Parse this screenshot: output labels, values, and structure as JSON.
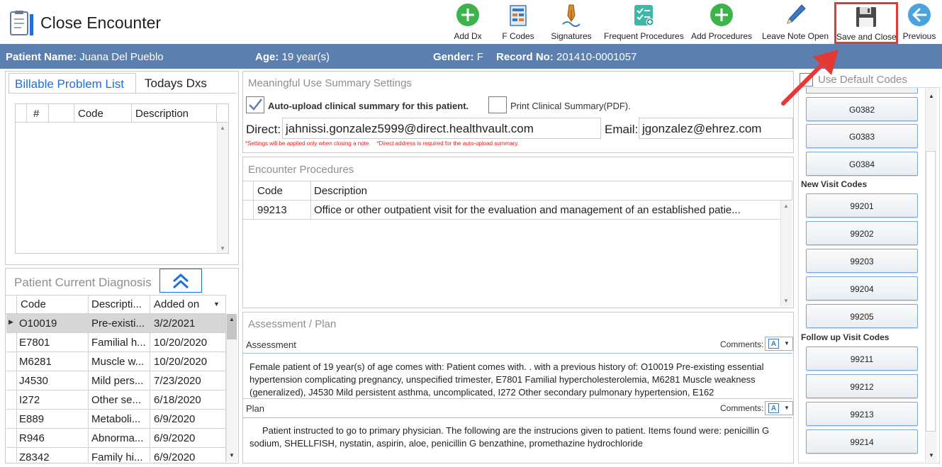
{
  "app": {
    "title": "Close Encounter"
  },
  "toolbar": [
    {
      "label": "Add Dx",
      "icon": "add-dx-icon"
    },
    {
      "label": "F Codes",
      "icon": "f-codes-icon"
    },
    {
      "label": "Signatures",
      "icon": "signatures-icon"
    },
    {
      "label": "Frequent Procedures",
      "icon": "frequent-procedures-icon"
    },
    {
      "label": "Add Procedures",
      "icon": "add-procedures-icon"
    },
    {
      "label": "Leave Note Open",
      "icon": "pencil-icon"
    },
    {
      "label": "Save and Close",
      "icon": "save-icon"
    },
    {
      "label": "Previous",
      "icon": "back-arrow-icon"
    }
  ],
  "patient": {
    "name_label": "Patient Name:",
    "name": "Juana Del Pueblo",
    "age_label": "Age:",
    "age": "19 year(s)",
    "gender_label": "Gender:",
    "gender": "F",
    "record_label": "Record No:",
    "record": "201410-0001057"
  },
  "problems": {
    "tabs": [
      "Billable Problem List",
      "Todays Dxs"
    ],
    "columns": [
      "#",
      "Code",
      "Description"
    ]
  },
  "diagnosis": {
    "title": "Patient Current Diagnosis",
    "columns": [
      "Code",
      "Descripti...",
      "Added on"
    ],
    "rows": [
      {
        "code": "O10019",
        "desc": "Pre-existi...",
        "date": "3/2/2021"
      },
      {
        "code": "E7801",
        "desc": "Familial h...",
        "date": "10/20/2020"
      },
      {
        "code": "M6281",
        "desc": "Muscle w...",
        "date": "10/20/2020"
      },
      {
        "code": "J4530",
        "desc": "Mild pers...",
        "date": "7/23/2020"
      },
      {
        "code": "I272",
        "desc": "Other se...",
        "date": "6/18/2020"
      },
      {
        "code": "E889",
        "desc": "Metaboli...",
        "date": "6/9/2020"
      },
      {
        "code": "R946",
        "desc": "Abnorma...",
        "date": "6/9/2020"
      },
      {
        "code": "Z8342",
        "desc": "Family hi...",
        "date": "6/9/2020"
      }
    ]
  },
  "meaningful": {
    "title": "Meaningful Use Summary Settings",
    "auto_upload_label": "Auto-upload clinical summary for this patient.",
    "auto_upload_checked": true,
    "print_label": "Print Clinical Summary(PDF).",
    "print_checked": false,
    "direct_label": "Direct:",
    "direct_value": "jahnissi.gonzalez5999@direct.healthvault.com",
    "email_label": "Email:",
    "email_value": "jgonzalez@ehrez.com",
    "note": "*Settings will be applied only when closing a note.    *Direct address is required for the auto-upload summary."
  },
  "procedures": {
    "title": "Encounter Procedures",
    "columns": [
      "Code",
      "Description"
    ],
    "rows": [
      {
        "code": "99213",
        "desc": "Office or other outpatient visit for the evaluation and management of an established patie..."
      }
    ]
  },
  "assessment_plan": {
    "title": "Assessment / Plan",
    "assessment_label": "Assessment",
    "comments_label": "Comments:",
    "assessment_text": "Female patient of 19 year(s) of age comes with:  Patient comes with. .     with a previous history of: O10019 Pre-existing essential hypertension complicating pregnancy, unspecified trimester, E7801 Familial hypercholesterolemia, M6281 Muscle weakness (generalized), J4530 Mild persistent asthma, uncomplicated, I272 Other secondary pulmonary hypertension, E162",
    "plan_label": "Plan",
    "plan_text": "Patient instructed to go to primary physician.  The following are the instrucions given to patient.     Items found were: penicillin G sodium, SHELLFISH, nystatin, aspirin, aloe, penicillin G benzathine, promethazine hydrochloride"
  },
  "codes": {
    "use_default_label": "Use Default Codes",
    "use_default_checked": false,
    "g_codes": [
      "G0382",
      "G0383",
      "G0384"
    ],
    "new_visit_label": "New Visit Codes",
    "new_visit": [
      "99201",
      "99202",
      "99203",
      "99204",
      "99205"
    ],
    "follow_up_label": "Follow up Visit Codes",
    "follow_up": [
      "99211",
      "99212",
      "99213",
      "99214"
    ]
  },
  "colors": {
    "patient_bar": "#5b7fae",
    "highlight": "#e53935",
    "accent": "#1e6fd9"
  }
}
